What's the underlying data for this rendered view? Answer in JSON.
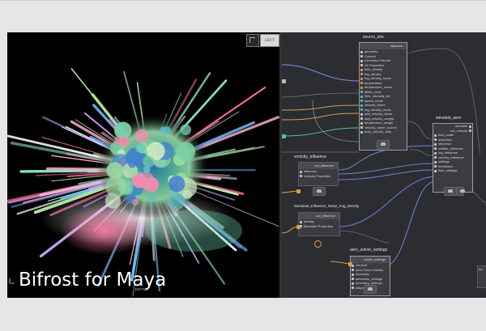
{
  "overlay": {
    "title": "Bifrost for Maya"
  },
  "viewport": {
    "view_cube_label": "LEFT",
    "camera_label": "persp"
  },
  "graph": {
    "nodes": {
      "source_sim": {
        "title": "source_sim",
        "header": "idsource",
        "ports": [
          "geometry",
          "Context",
          "Geometry Volume…",
          "Air Properties",
          "fluid_density",
          "fog_density",
          "fog_density_mode",
          "temperature",
          "temperature_mode",
          "sfield_cond",
          "fluid_viscosity_div",
          "speed_mode",
          "velocity_blend",
          "fog_density_mode",
          "add_velocity_factor",
          "add_velocity_weight",
          "temperature_weight",
          "velocity_mode_source",
          "auto_velocity_bias"
        ]
      },
      "simulate_aero": {
        "title": "simulate_aero",
        "ports": [
          "fluid_scale",
          "advection",
          "influence",
          "collider_influence",
          "fog_influence",
          "velocity_influence",
          "settings",
          "terminator",
          "fluid_settings"
        ],
        "out_ports": [
          "simulate",
          "out_velocity"
        ]
      },
      "vorticity_influence": {
        "title": "vorticity_influence",
        "header": "out_influence",
        "ports": [
          "influence",
          "Vorticity Properties"
        ]
      },
      "modulate_influence": {
        "title": "Modulate_Influence_Noise_Fog_density",
        "header": "out_influence",
        "ports": [
          "density",
          "Modulate Properties"
        ]
      },
      "aero_solver_settings": {
        "title": "aero_solver_settings",
        "header": "solver_settings",
        "ports": [
          "General",
          "Aero Solver Details",
          "Accuracy",
          "advection_settings",
          "boundary_settings",
          "diagnostics"
        ]
      }
    },
    "edge_tab_label": "Ins"
  }
}
